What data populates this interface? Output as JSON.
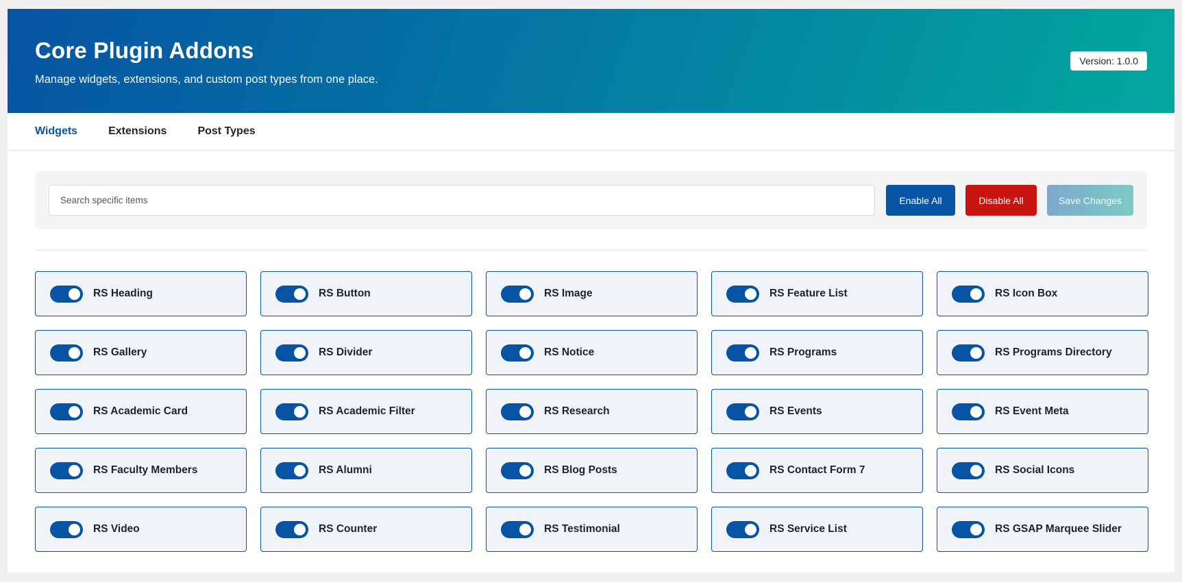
{
  "header": {
    "title": "Core Plugin Addons",
    "subtitle": "Manage widgets, extensions, and custom post types from one place.",
    "version": "Version: 1.0.0"
  },
  "tabs": [
    {
      "label": "Widgets",
      "active": true
    },
    {
      "label": "Extensions",
      "active": false
    },
    {
      "label": "Post Types",
      "active": false
    }
  ],
  "toolbar": {
    "search_placeholder": "Search specific items",
    "search_value": "",
    "enable_all_label": "Enable All",
    "disable_all_label": "Disable All",
    "save_label": "Save Changes"
  },
  "colors": {
    "primary": "#0654a3",
    "danger": "#c7160f",
    "accent": "#02a89e",
    "card_bg": "#f0f4f9"
  },
  "widgets": [
    {
      "label": "RS Heading",
      "enabled": true
    },
    {
      "label": "RS Button",
      "enabled": true
    },
    {
      "label": "RS Image",
      "enabled": true
    },
    {
      "label": "RS Feature List",
      "enabled": true
    },
    {
      "label": "RS Icon Box",
      "enabled": true
    },
    {
      "label": "RS Gallery",
      "enabled": true
    },
    {
      "label": "RS Divider",
      "enabled": true
    },
    {
      "label": "RS Notice",
      "enabled": true
    },
    {
      "label": "RS Programs",
      "enabled": true
    },
    {
      "label": "RS Programs Directory",
      "enabled": true
    },
    {
      "label": "RS Academic Card",
      "enabled": true
    },
    {
      "label": "RS Academic Filter",
      "enabled": true
    },
    {
      "label": "RS Research",
      "enabled": true
    },
    {
      "label": "RS Events",
      "enabled": true
    },
    {
      "label": "RS Event Meta",
      "enabled": true
    },
    {
      "label": "RS Faculty Members",
      "enabled": true
    },
    {
      "label": "RS Alumni",
      "enabled": true
    },
    {
      "label": "RS Blog Posts",
      "enabled": true
    },
    {
      "label": "RS Contact Form 7",
      "enabled": true
    },
    {
      "label": "RS Social Icons",
      "enabled": true
    },
    {
      "label": "RS Video",
      "enabled": true
    },
    {
      "label": "RS Counter",
      "enabled": true
    },
    {
      "label": "RS Testimonial",
      "enabled": true
    },
    {
      "label": "RS Service List",
      "enabled": true
    },
    {
      "label": "RS GSAP Marquee Slider",
      "enabled": true
    }
  ]
}
